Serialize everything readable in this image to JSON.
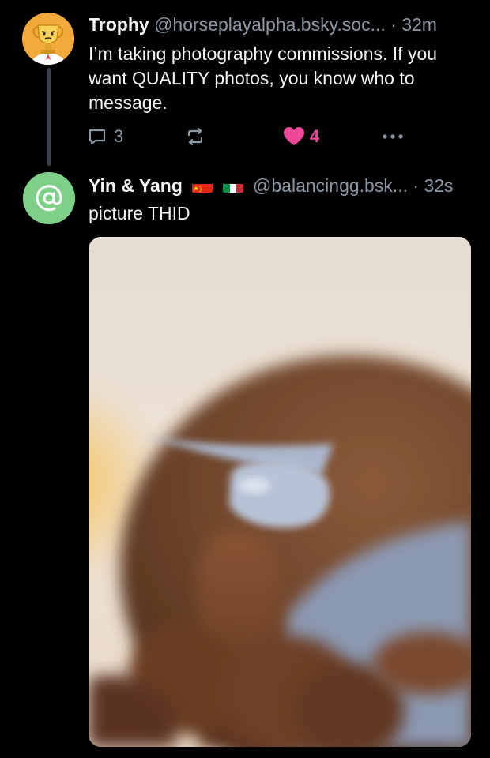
{
  "posts": [
    {
      "author_name": "Trophy",
      "handle": "@horseplayalpha.bsky.soc...",
      "time": "· 32m",
      "text": "I’m taking photography commissions. If you want QUALITY photos, you know who to message.",
      "reply_count": "3",
      "like_count": "4",
      "liked": true,
      "avatar_icon": "trophy-avatar-icon"
    },
    {
      "author_name": "Yin & Yang",
      "flags": [
        "china-flag-icon",
        "italy-flag-icon"
      ],
      "handle": "@balancingg.bsk...",
      "time": "· 32s",
      "text": "picture THID",
      "avatar_icon": "at-sign-icon",
      "media_description_icon": "blurred-photo-image"
    }
  ],
  "colors": {
    "background": "#000000",
    "text": "#f1f3f5",
    "muted": "#8b98a5",
    "like": "#ec4899",
    "avatar_green": "#7ed089"
  }
}
